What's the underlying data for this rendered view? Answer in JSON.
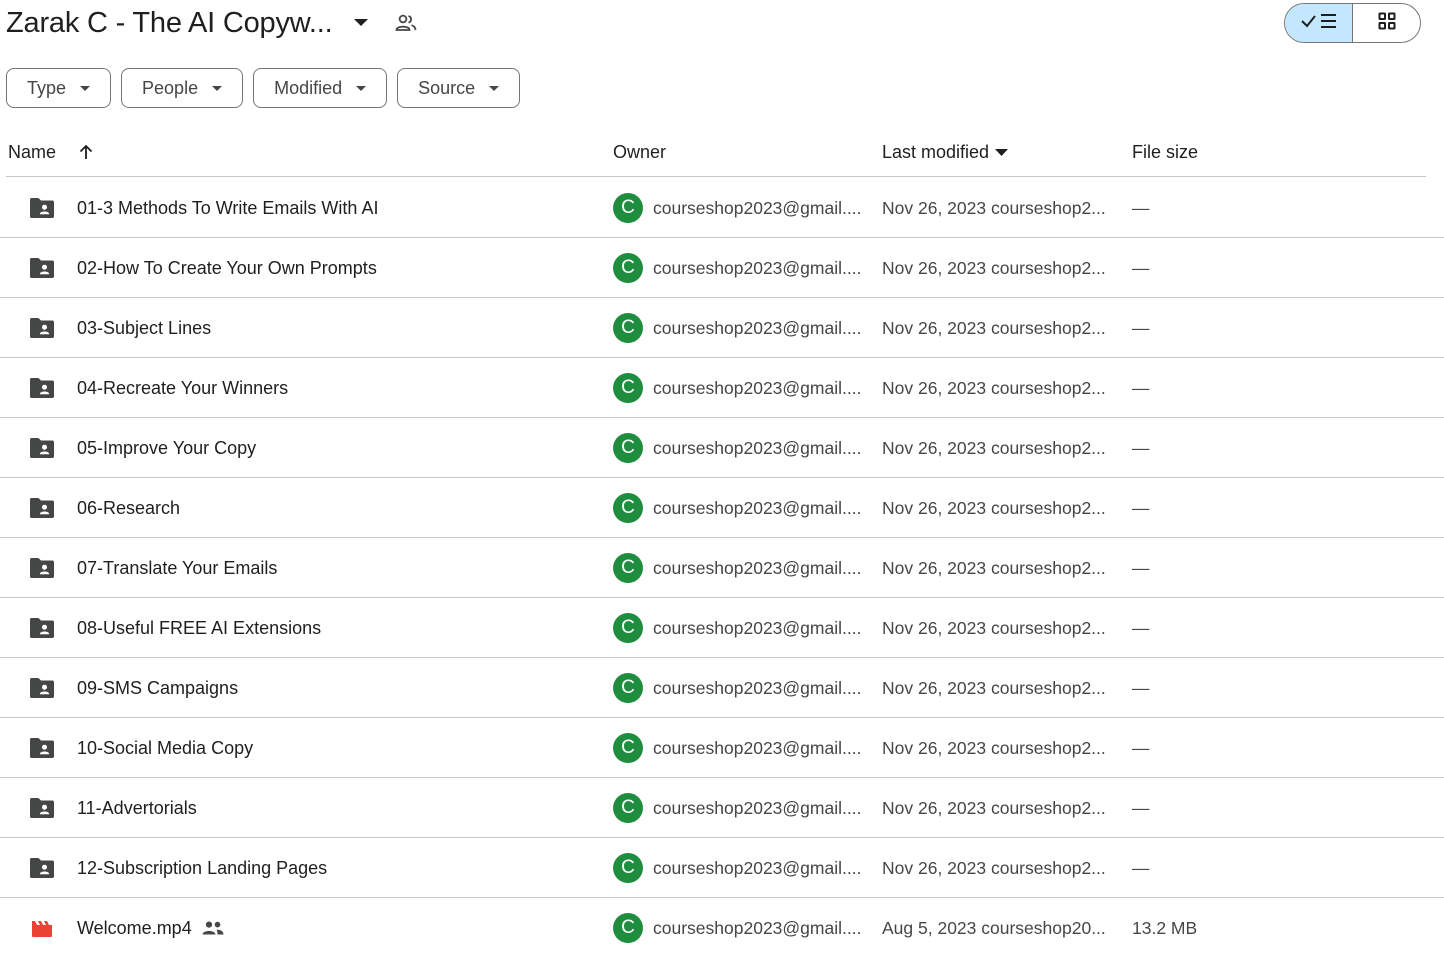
{
  "header": {
    "title": "Zarak C - The AI Copyw...",
    "caret_icon": "arrow-drop-down-icon",
    "shared_icon": "people-outline-icon"
  },
  "view_toggle": {
    "list_icon": "check-list-icon",
    "grid_icon": "grid-icon",
    "active": "list",
    "active_color": "#c2e7ff"
  },
  "filters": [
    {
      "label": "Type"
    },
    {
      "label": "People"
    },
    {
      "label": "Modified"
    },
    {
      "label": "Source"
    }
  ],
  "columns": {
    "name": "Name",
    "owner": "Owner",
    "last_modified": "Last modified",
    "file_size": "File size",
    "sort_column": "Name",
    "sort_direction": "ascending"
  },
  "rows": [
    {
      "name": "01-3 Methods To Write Emails With AI",
      "type": "shared-folder",
      "avatar": "C",
      "owner": "courseshop2023@gmail....",
      "modified": "Nov 26, 2023 courseshop2...",
      "size": "—"
    },
    {
      "name": "02-How To Create Your Own Prompts",
      "type": "shared-folder",
      "avatar": "C",
      "owner": "courseshop2023@gmail....",
      "modified": "Nov 26, 2023 courseshop2...",
      "size": "—"
    },
    {
      "name": "03-Subject Lines",
      "type": "shared-folder",
      "avatar": "C",
      "owner": "courseshop2023@gmail....",
      "modified": "Nov 26, 2023 courseshop2...",
      "size": "—"
    },
    {
      "name": "04-Recreate Your Winners",
      "type": "shared-folder",
      "avatar": "C",
      "owner": "courseshop2023@gmail....",
      "modified": "Nov 26, 2023 courseshop2...",
      "size": "—"
    },
    {
      "name": "05-Improve Your Copy",
      "type": "shared-folder",
      "avatar": "C",
      "owner": "courseshop2023@gmail....",
      "modified": "Nov 26, 2023 courseshop2...",
      "size": "—"
    },
    {
      "name": "06-Research",
      "type": "shared-folder",
      "avatar": "C",
      "owner": "courseshop2023@gmail....",
      "modified": "Nov 26, 2023 courseshop2...",
      "size": "—"
    },
    {
      "name": "07-Translate Your Emails",
      "type": "shared-folder",
      "avatar": "C",
      "owner": "courseshop2023@gmail....",
      "modified": "Nov 26, 2023 courseshop2...",
      "size": "—"
    },
    {
      "name": "08-Useful FREE AI Extensions",
      "type": "shared-folder",
      "avatar": "C",
      "owner": "courseshop2023@gmail....",
      "modified": "Nov 26, 2023 courseshop2...",
      "size": "—"
    },
    {
      "name": "09-SMS Campaigns",
      "type": "shared-folder",
      "avatar": "C",
      "owner": "courseshop2023@gmail....",
      "modified": "Nov 26, 2023 courseshop2...",
      "size": "—"
    },
    {
      "name": "10-Social Media Copy",
      "type": "shared-folder",
      "avatar": "C",
      "owner": "courseshop2023@gmail....",
      "modified": "Nov 26, 2023 courseshop2...",
      "size": "—"
    },
    {
      "name": "11-Advertorials",
      "type": "shared-folder",
      "avatar": "C",
      "owner": "courseshop2023@gmail....",
      "modified": "Nov 26, 2023 courseshop2...",
      "size": "—"
    },
    {
      "name": "12-Subscription Landing Pages",
      "type": "shared-folder",
      "avatar": "C",
      "owner": "courseshop2023@gmail....",
      "modified": "Nov 26, 2023 courseshop2...",
      "size": "—"
    },
    {
      "name": "Welcome.mp4",
      "type": "video",
      "shared": true,
      "avatar": "C",
      "owner": "courseshop2023@gmail....",
      "modified": "Aug 5, 2023 courseshop20...",
      "size": "13.2 MB"
    }
  ],
  "colors": {
    "avatar": "#1e8e3e",
    "folder_icon": "#444746",
    "video_icon": "#ea4335",
    "divider": "#c7c7c7"
  }
}
